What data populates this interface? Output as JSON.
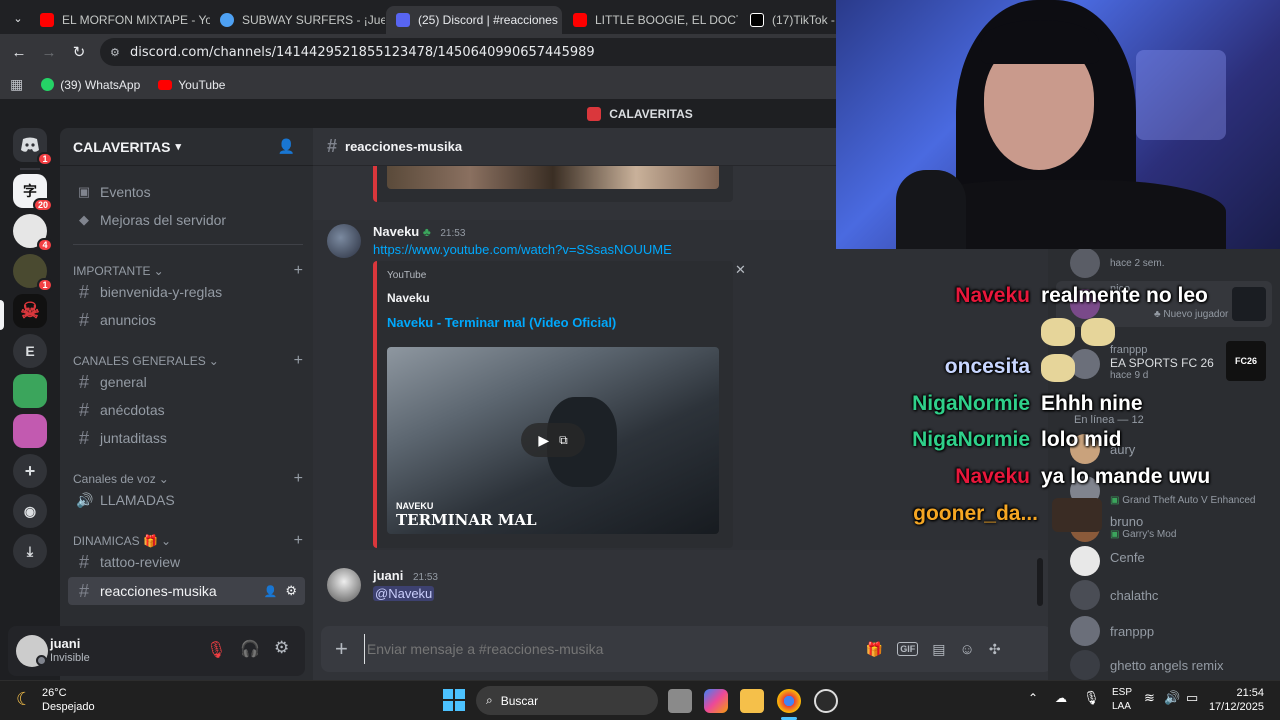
{
  "browser": {
    "tabs": [
      {
        "title": "EL MORFON MIXTAPE - Yo",
        "color": "#ff0000"
      },
      {
        "title": "SUBWAY SURFERS - ¡Juega",
        "color": "#4ea1f3"
      },
      {
        "title": "(25) Discord | #reacciones",
        "color": "#5865f2",
        "badge": "25"
      },
      {
        "title": "LITTLE BOOGIE, EL DOCTO",
        "color": "#ff0000"
      },
      {
        "title": "(17)TikTok - Ma",
        "color": "#ffffff"
      }
    ],
    "url": "discord.com/channels/1414429521855123478/1450640990657445989",
    "bookmarks": [
      {
        "label": "(39) WhatsApp",
        "icon": "whatsapp-icon"
      },
      {
        "label": "YouTube",
        "icon": "youtube-icon"
      }
    ]
  },
  "discord": {
    "app_title": "CALAVERITAS",
    "server_name": "CALAVERITAS",
    "guild_badges": [
      "1",
      "20",
      "4",
      "1"
    ],
    "top_items": [
      {
        "label": "Eventos",
        "icon": "calendar-icon"
      },
      {
        "label": "Mejoras del servidor",
        "icon": "boost-icon"
      }
    ],
    "categories": [
      {
        "label": "IMPORTANTE"
      },
      {
        "label": "CANALES GENERALES"
      },
      {
        "label": "Canales de voz"
      },
      {
        "label": "DINAMICAS 🎁"
      }
    ],
    "channels": {
      "importante": [
        "bienvenida-y-reglas",
        "anuncios"
      ],
      "generales": [
        "general",
        "anécdotas",
        "juntaditass"
      ],
      "voz": [
        "LLAMADAS"
      ],
      "dinamicas": [
        "tattoo-review",
        "reacciones-musika"
      ]
    },
    "user": {
      "name": "juani",
      "status": "Invisible"
    },
    "channel_title": "reacciones-musika",
    "messages": [
      {
        "author": "Naveku",
        "time": "21:53",
        "link": "https://www.youtube.com/watch?v=SSsasNOUUME",
        "embed": {
          "provider": "YouTube",
          "author": "Naveku",
          "title": "Naveku - Terminar mal (Video Oficial)",
          "thumb_line1": "NAVEKU",
          "thumb_line2": "TERMINAR MAL"
        }
      },
      {
        "author": "juani",
        "time": "21:53",
        "mention": "@Naveku"
      }
    ],
    "composer_placeholder": "Enviar mensaje a #reacciones-musika",
    "members": [
      {
        "name": "",
        "sub": "hace 2 sem."
      },
      {
        "name": "nico",
        "sub": "Nuevo jugador"
      },
      {
        "name": "franppp",
        "sub": "EA SPORTS FC 26",
        "sub2": "hace 9 d"
      },
      {
        "header": "En línea — 12"
      },
      {
        "name": "aury",
        "sub": ""
      },
      {
        "name": "",
        "sub": "Grand Theft Auto V Enhanced"
      },
      {
        "name": "bruno",
        "sub": "Garry's Mod"
      },
      {
        "name": "Cenfe",
        "sub": ""
      },
      {
        "name": "chalathc",
        "sub": ""
      },
      {
        "name": "franppp",
        "sub": ""
      },
      {
        "name": "ghetto angels remix",
        "sub": ""
      }
    ],
    "fc26_label": "FC26"
  },
  "overlay_chat": [
    {
      "user": "Naveku",
      "color": "#e8173b",
      "text": "realmente no leo"
    },
    {
      "user": "oncesita",
      "color": "#c8d6ff",
      "text": ""
    },
    {
      "user": "NigaNormie",
      "color": "#2fd08a",
      "text": "Ehhh nine"
    },
    {
      "user": "NigaNormie",
      "color": "#2fd08a",
      "text": "lolo mid"
    },
    {
      "user": "Naveku",
      "color": "#e8173b",
      "text": "ya lo mande uwu"
    },
    {
      "user": "gooner_da...",
      "color": "#f5a623",
      "text": ""
    }
  ],
  "taskbar": {
    "weather_temp": "26°C",
    "weather_desc": "Despejado",
    "search_label": "Buscar",
    "lang1": "ESP",
    "lang2": "LAA",
    "time": "21:54",
    "date": "17/12/2025"
  }
}
